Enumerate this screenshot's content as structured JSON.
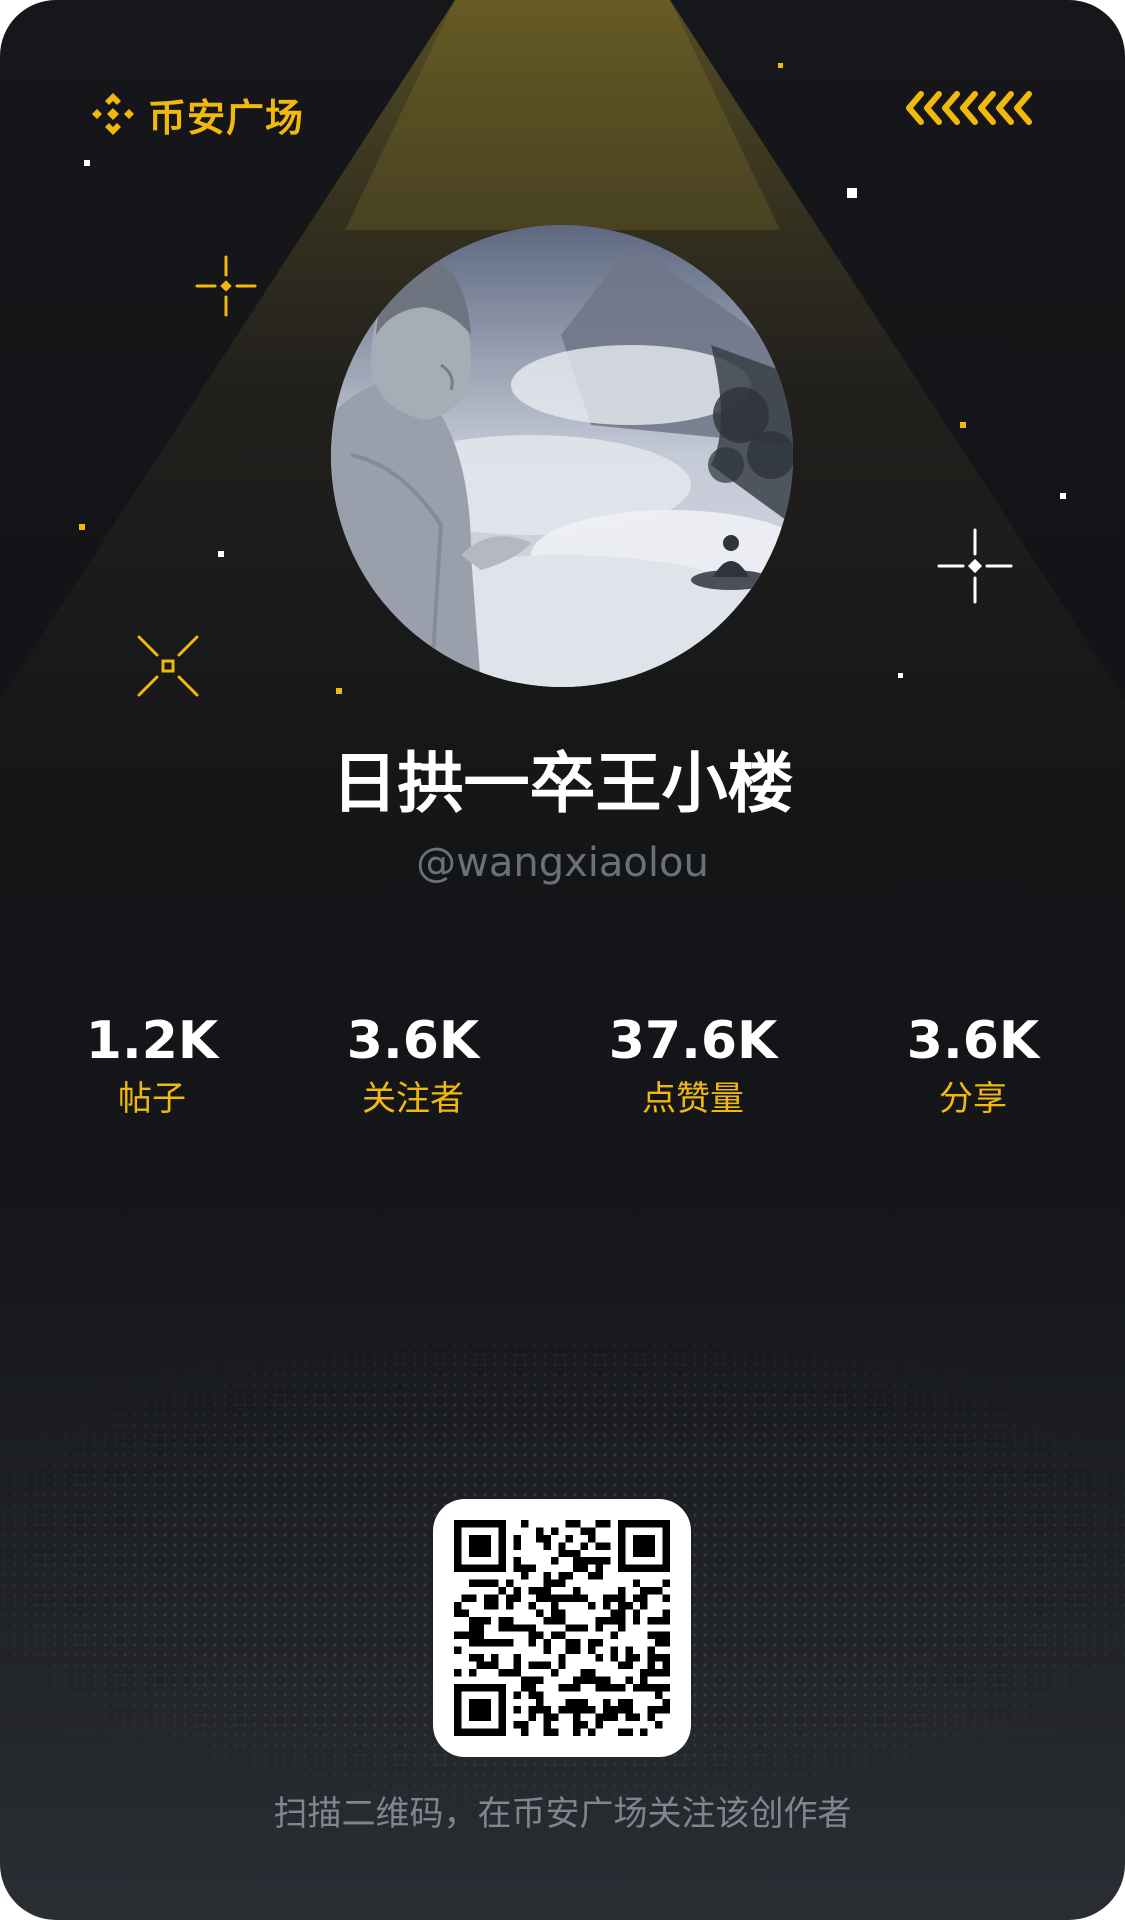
{
  "brand": {
    "logo_text": "币安广场",
    "logo_icon": "binance-diamond-icon",
    "accent_color": "#f0b90b",
    "header_decoration": "double-chevron-left-icon"
  },
  "profile": {
    "display_name": "日拱一卒王小楼",
    "handle": "@wangxiaolou",
    "avatar": "buddha-statue-clouds-avatar"
  },
  "stats": [
    {
      "value": "1.2K",
      "label": "帖子"
    },
    {
      "value": "3.6K",
      "label": "关注者"
    },
    {
      "value": "37.6K",
      "label": "点赞量"
    },
    {
      "value": "3.6K",
      "label": "分享"
    }
  ],
  "qr": {
    "icon": "qr-code-icon"
  },
  "footer": {
    "text": "扫描二维码，在币安广场关注该创作者"
  }
}
